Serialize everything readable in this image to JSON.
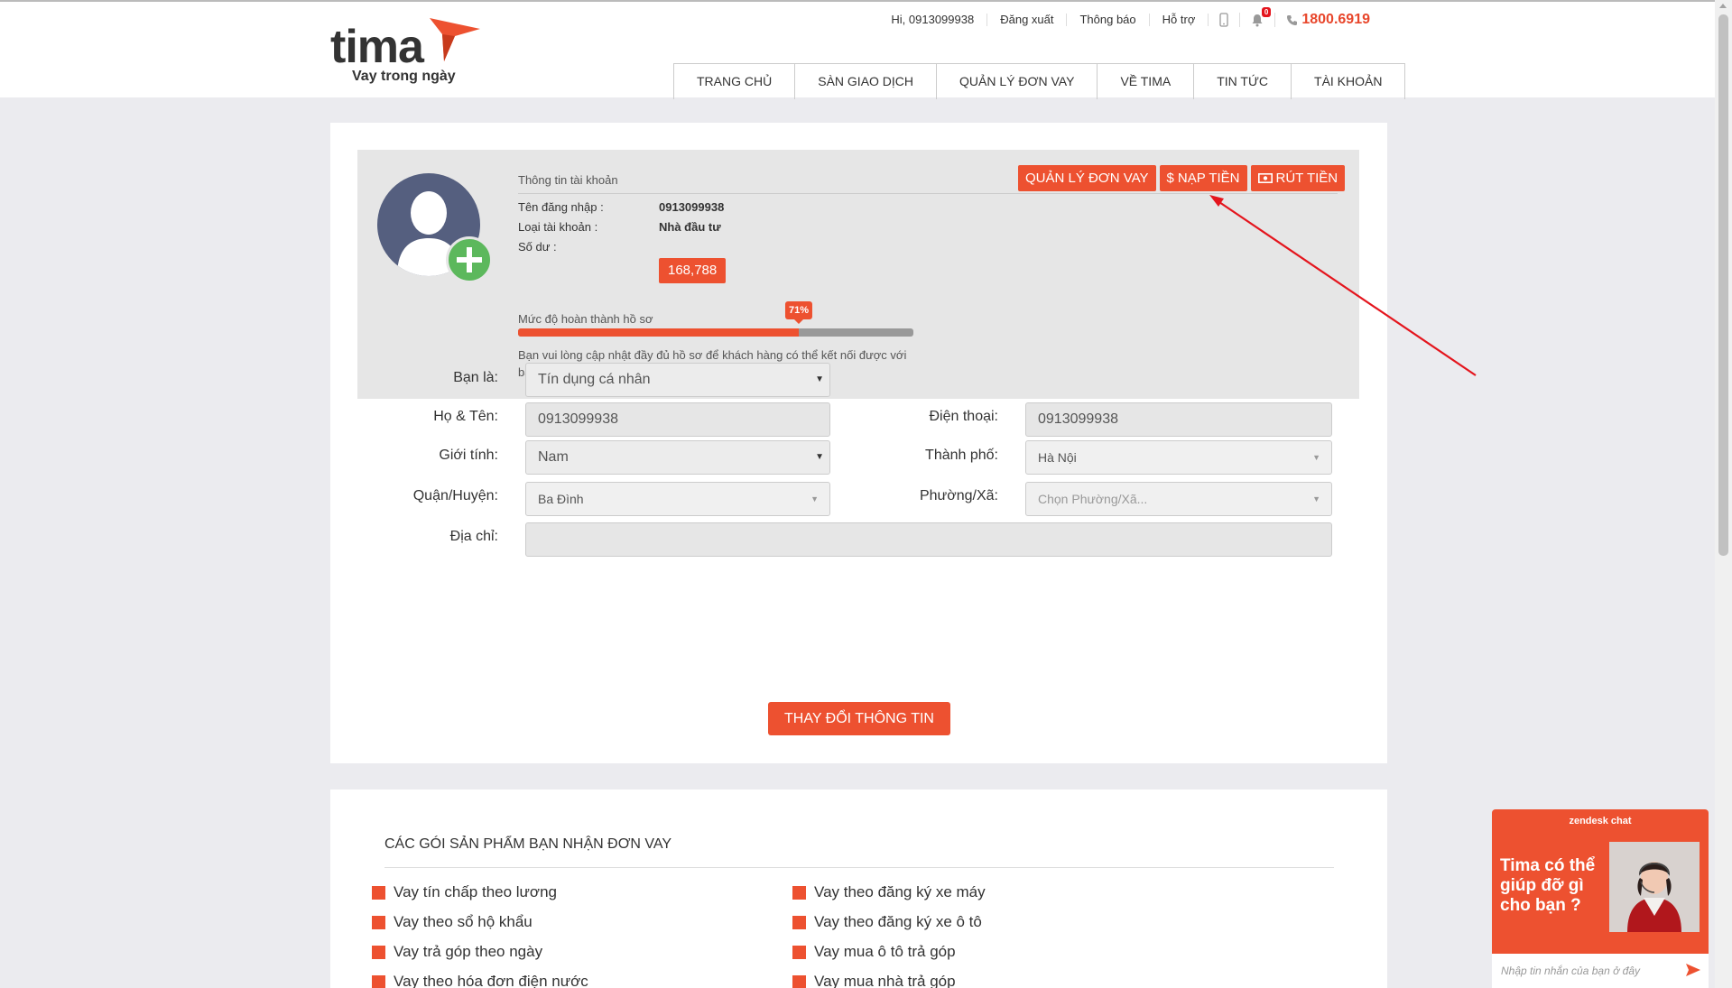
{
  "brand": {
    "logo_word": "tima",
    "tagline": "Vay trong ngày"
  },
  "topbar": {
    "greeting": "Hi, 0913099938",
    "logout": "Đăng xuất",
    "notifications": "Thông báo",
    "support": "Hỗ trợ",
    "bell_count": "0",
    "hotline": "1800.6919"
  },
  "nav": [
    "TRANG CHỦ",
    "SÀN GIAO DỊCH",
    "QUẢN LÝ ĐƠN VAY",
    "VỀ TIMA",
    "TIN TỨC",
    "TÀI KHOẢN"
  ],
  "profile": {
    "section_title": "Thông tin tài khoản",
    "buttons": {
      "manage": "QUẢN LÝ ĐƠN VAY",
      "deposit": "NẠP TIỀN",
      "withdraw": "RÚT TIỀN"
    },
    "username_label": "Tên đăng nhập :",
    "username": "0913099938",
    "account_type_label": "Loại tài khoản  :",
    "account_type": "Nhà đầu tư",
    "balance_label": "Số dư  :",
    "balance": "168,788",
    "completion_label": "Mức độ hoàn thành hồ sơ",
    "completion_text": "71%",
    "completion_percent": 71,
    "completion_note": "Bạn vui lòng cập nhật đầy đủ hồ sơ để khách hàng có thể kết nối được với bạn."
  },
  "form": {
    "you_are_label": "Bạn là:",
    "you_are_value": "Tín dụng cá nhân",
    "name_label": "Họ & Tên:",
    "name_value": "0913099938",
    "phone_label": "Điện thoại:",
    "phone_value": "0913099938",
    "gender_label": "Giới tính:",
    "gender_value": "Nam",
    "city_label": "Thành phố:",
    "city_value": "Hà Nội",
    "district_label": "Quận/Huyện:",
    "district_value": "Ba Đình",
    "ward_label": "Phường/Xã:",
    "ward_placeholder": "Chọn Phường/Xã...",
    "address_label": "Địa chỉ:",
    "address_value": "",
    "submit": "THAY ĐỔI THÔNG TIN"
  },
  "products": {
    "title": "CÁC GÓI SẢN PHẨM BẠN NHẬN ĐƠN VAY",
    "left": [
      "Vay tín chấp theo lương",
      "Vay theo sổ hộ khẩu",
      "Vay trả góp theo ngày",
      "Vay theo hóa đơn điện nước"
    ],
    "right": [
      "Vay theo đăng ký xe máy",
      "Vay theo đăng ký xe ô tô",
      "Vay mua ô tô trả góp",
      "Vay mua nhà trả góp"
    ]
  },
  "chat": {
    "brand": "zendesk chat",
    "prompt": "Tima có thể giúp đỡ gì cho bạn ?",
    "input_placeholder": "Nhập tin nhắn của bạn ở đây"
  },
  "colors": {
    "accent": "#ed5130",
    "success": "#5cb85c",
    "avatar_bg": "#555f7f",
    "annotation": "#e4151d"
  }
}
